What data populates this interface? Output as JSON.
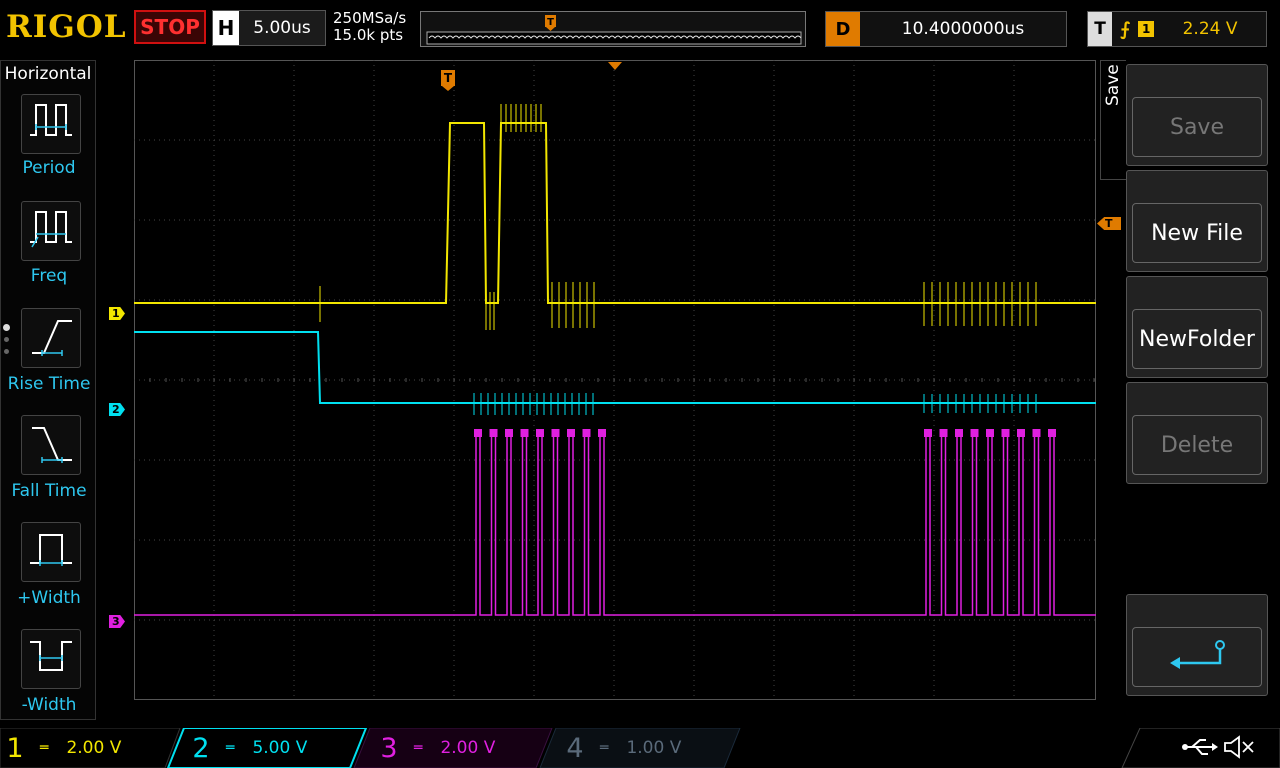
{
  "brand": "RIGOL",
  "status": "STOP",
  "horizontal": {
    "label": "H",
    "timebase": "5.00us",
    "sample_rate": "250MSa/s",
    "memory_depth": "15.0k pts"
  },
  "delay": {
    "label": "D",
    "value": "10.4000000us"
  },
  "trigger": {
    "label": "T",
    "source": "1",
    "level": "2.24 V"
  },
  "left_menu": {
    "title": "Horizontal",
    "items": [
      "Period",
      "Freq",
      "Rise Time",
      "Fall Time",
      "+Width",
      "-Width"
    ]
  },
  "right_menu": {
    "tab": "Save",
    "buttons": [
      "Save",
      "New File",
      "NewFolder",
      "Delete"
    ]
  },
  "channels": [
    {
      "num": "1",
      "coupling": "═",
      "scale": "2.00 V",
      "color": "#f2e600",
      "active": true
    },
    {
      "num": "2",
      "coupling": "═",
      "scale": "5.00 V",
      "color": "#00e0f0",
      "active": true
    },
    {
      "num": "3",
      "coupling": "═",
      "scale": "2.00 V",
      "color": "#e020e0",
      "active": true
    },
    {
      "num": "4",
      "coupling": "═",
      "scale": "1.00 V",
      "color": "#5a6a7a",
      "active": false
    }
  ],
  "marker_labels": {
    "trigger": "T",
    "ch1": "1",
    "ch2": "2",
    "ch3": "3"
  },
  "colors": {
    "ch1": "#f2e600",
    "ch2": "#00e0f0",
    "ch3": "#e020e0",
    "ch4": "#5a6a7a",
    "trigger": "#e07b00",
    "menu_accent": "#2ec8f0",
    "stop": "#ff3030"
  }
}
